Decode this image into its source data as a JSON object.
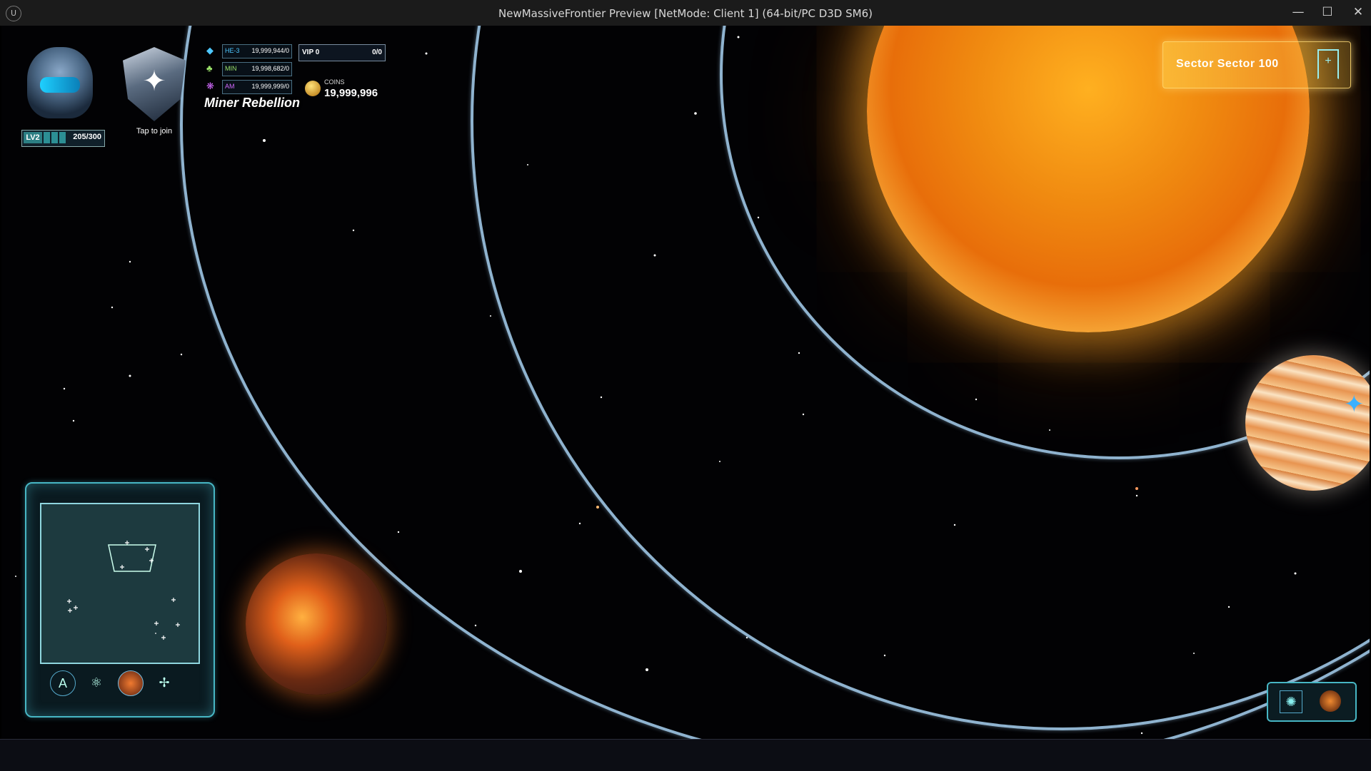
{
  "window": {
    "title": "NewMassiveFrontier Preview [NetMode: Client 1]  (64-bit/PC D3D SM6)",
    "logo_text": "U",
    "minimize": "—",
    "maximize": "☐",
    "close": "✕"
  },
  "player": {
    "level": "LV2",
    "xp": "205/300",
    "xp_progress": 0.683
  },
  "guild": {
    "join_label": "Tap to join",
    "name": "Miner Rebellion"
  },
  "resources": [
    {
      "name": "HE-3",
      "value": "19,999,944/0",
      "color": "#4ec8ff",
      "icon": "he3-crystal-icon"
    },
    {
      "name": "MIN",
      "value": "19,998,682/0",
      "color": "#9be36a",
      "icon": "mineral-icon"
    },
    {
      "name": "AM",
      "value": "19,999,999/0",
      "color": "#d36bff",
      "icon": "antimatter-icon"
    }
  ],
  "vip": {
    "label": "VIP 0",
    "value": "0/0"
  },
  "coins": {
    "label": "COINS",
    "value": "19,999,996"
  },
  "sector": {
    "label": "Sector Sector 100"
  },
  "colors": {
    "orbit": "#8fb3cf",
    "hud_accent": "#47b6c4",
    "sun": "#f08a10"
  }
}
